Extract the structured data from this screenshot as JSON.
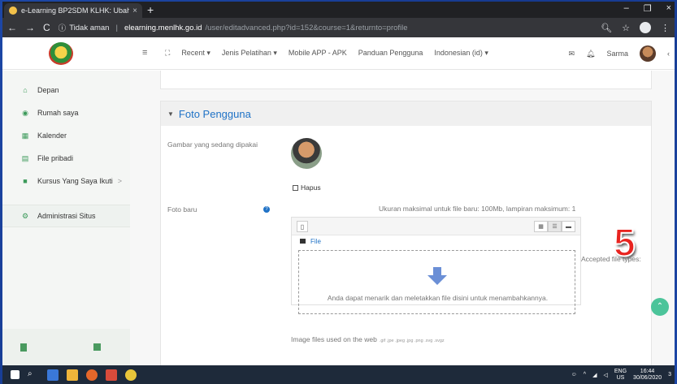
{
  "browser": {
    "tab_title": "e-Learning BP2SDM KLHK: Ubah",
    "tab_close": "×",
    "new_tab": "+",
    "window_controls": [
      "–",
      "❐",
      "×"
    ],
    "nav": {
      "back": "←",
      "forward": "→",
      "reload": "C"
    },
    "security_label": "Tidak aman",
    "url_host": "elearning.menlhk.go.id",
    "url_path": "/user/editadvanced.php?id=152&course=1&returnto=profile"
  },
  "navbar": {
    "menu_toggle": "≡",
    "expand_icon": "⛶",
    "items": [
      {
        "label": "Recent ▾"
      },
      {
        "label": "Jenis Pelatihan ▾"
      },
      {
        "label": "Mobile APP - APK"
      },
      {
        "label": "Panduan Pengguna"
      },
      {
        "label": "Indonesian (id) ▾"
      }
    ],
    "user_name": "Sarma",
    "collapse": "‹"
  },
  "sidebar": {
    "items": [
      {
        "label": "Depan",
        "icon": "home-icon"
      },
      {
        "label": "Rumah saya",
        "icon": "dashboard-icon"
      },
      {
        "label": "Kalender",
        "icon": "calendar-icon"
      },
      {
        "label": "File pribadi",
        "icon": "file-icon"
      },
      {
        "label": "Kursus Yang Saya Ikuti",
        "icon": "course-icon",
        "chevron": ">"
      },
      {
        "label": "Administrasi Situs",
        "icon": "gear-icon"
      }
    ]
  },
  "section": {
    "title": "Foto Pengguna",
    "current_label": "Gambar yang sedang dipakai",
    "delete_label": "Hapus",
    "new_photo_label": "Foto baru",
    "size_limit": "Ukuran maksimal untuk file baru: 100Mb, lampiran maksimum: 1",
    "path_root": "File",
    "dropzone_text": "Anda dapat menarik dan meletakkan file disini untuk menambahkannya.",
    "accepted_types": "Accepted file types:",
    "image_files_label": "Image files used on the web",
    "image_files_ext": ".gif .jpe .jpeg .jpg .png .svg .svgz"
  },
  "overlay_number": "5",
  "taskbar": {
    "lang": "ENG",
    "region": "US",
    "time": "16:44",
    "date": "30/06/2020",
    "notif": "3"
  },
  "colors": {
    "accent": "#1f72c6",
    "sidebar_icon": "#3c9a5a",
    "scroll_button": "#4cc49a"
  }
}
